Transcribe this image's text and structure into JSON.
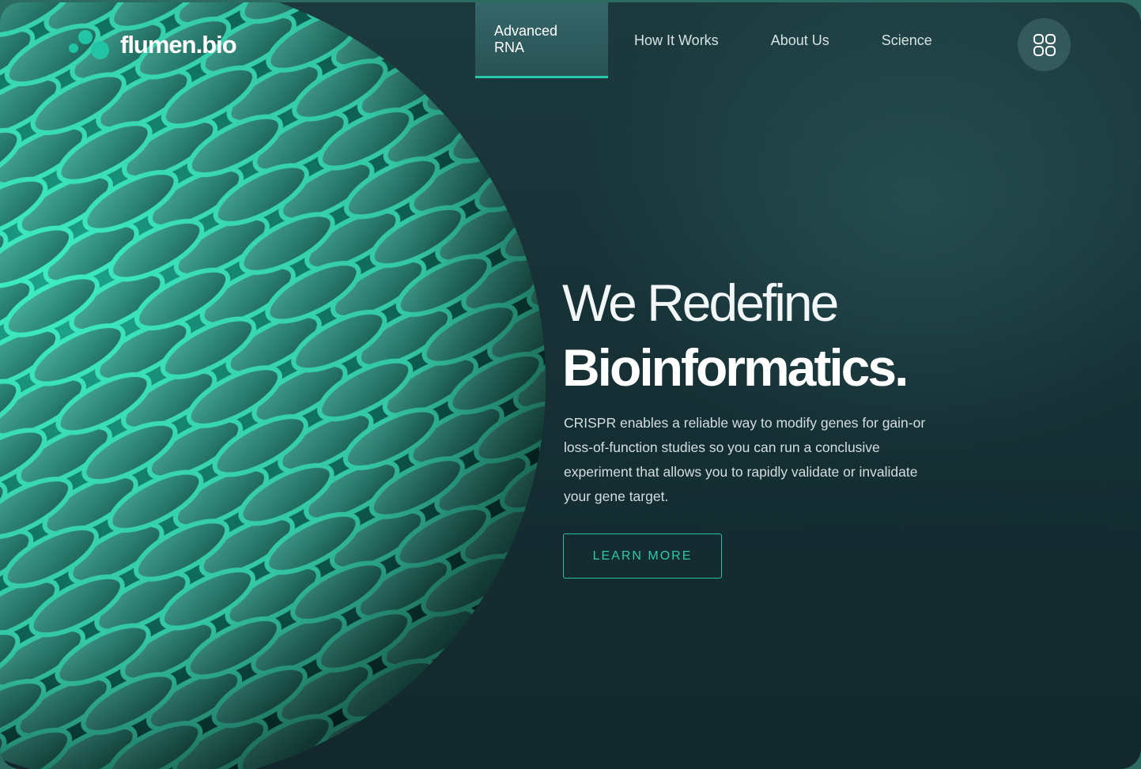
{
  "brand": {
    "name": "flumen.bio",
    "accent": "#21c4a4"
  },
  "nav": {
    "items": [
      {
        "label": "Advanced RNA",
        "active": true
      },
      {
        "label": "How It Works",
        "active": false
      },
      {
        "label": "About Us",
        "active": false
      },
      {
        "label": "Science",
        "active": false
      }
    ],
    "menu_icon": "grid-icon"
  },
  "hero": {
    "line1": "We Redefine",
    "line2": "Bioinformatics.",
    "description": "CRISPR enables a reliable way to modify genes for gain-or loss-of-function studies so you can run a conclusive experiment that allows you to rapidly validate or invalidate your gene target.",
    "cta_label": "LEARN MORE"
  },
  "decoration": {
    "image": "green-cellular-sphere-illustration"
  }
}
